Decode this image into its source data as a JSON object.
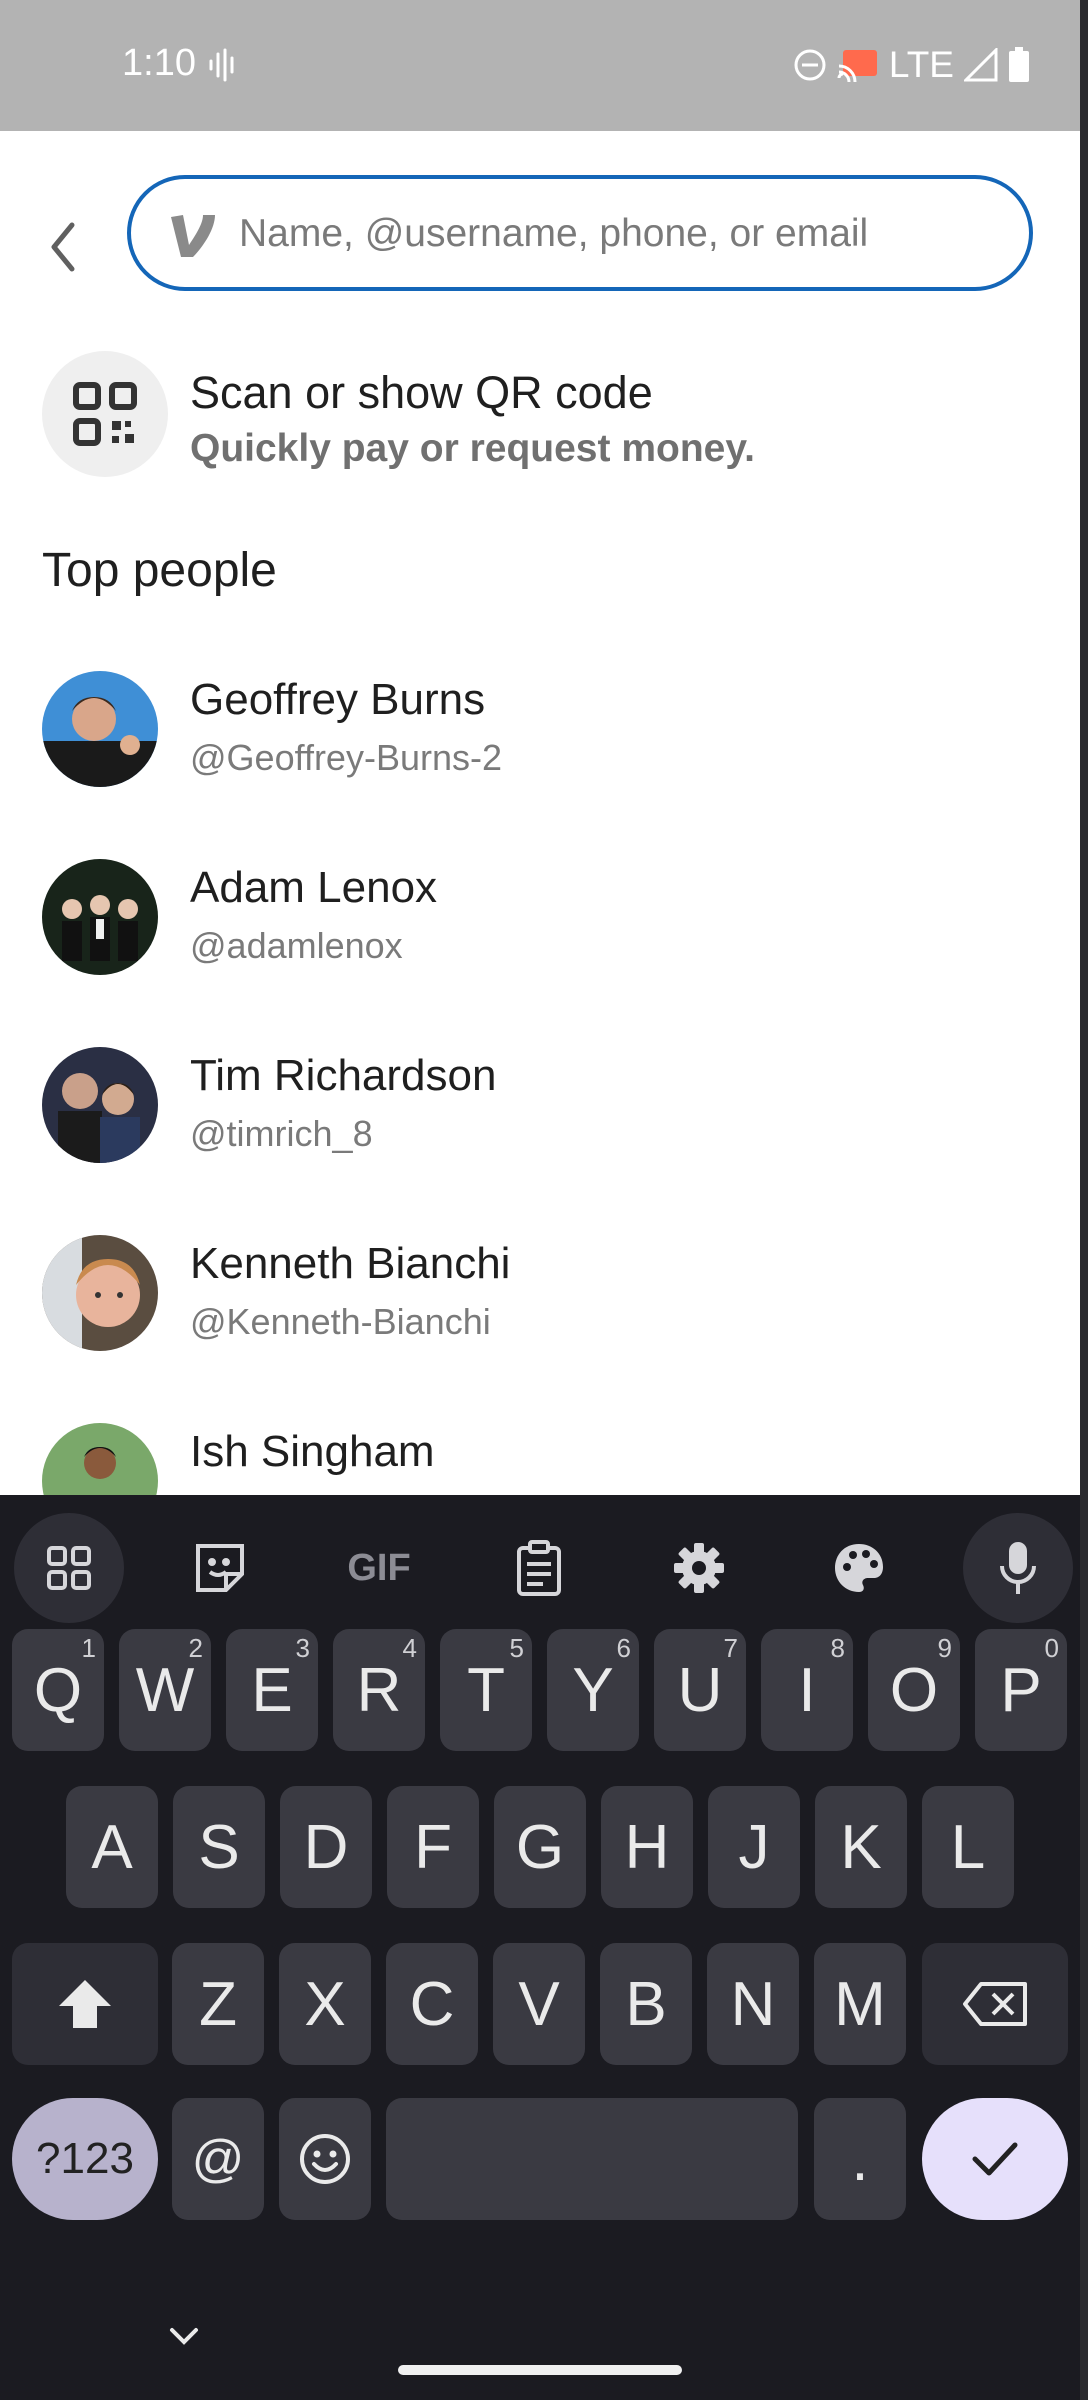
{
  "status": {
    "time": "1:10",
    "network": "LTE"
  },
  "search": {
    "placeholder": "Name, @username, phone, or email",
    "value": ""
  },
  "qr": {
    "title": "Scan or show QR code",
    "subtitle": "Quickly pay or request money."
  },
  "top_people": {
    "title": "Top people",
    "people": [
      {
        "name": "Geoffrey Burns",
        "username": "@Geoffrey-Burns-2"
      },
      {
        "name": "Adam Lenox",
        "username": "@adamlenox"
      },
      {
        "name": "Tim Richardson",
        "username": "@timrich_8"
      },
      {
        "name": "Kenneth Bianchi",
        "username": "@Kenneth-Bianchi"
      },
      {
        "name": "Ish Singham",
        "username": ""
      }
    ]
  },
  "keyboard": {
    "toolbar": [
      "apps-grid-icon",
      "sticker-icon",
      "GIF",
      "clipboard-icon",
      "gear-icon",
      "palette-icon",
      "mic-icon"
    ],
    "gif_label": "GIF",
    "row1": [
      {
        "k": "Q",
        "n": "1"
      },
      {
        "k": "W",
        "n": "2"
      },
      {
        "k": "E",
        "n": "3"
      },
      {
        "k": "R",
        "n": "4"
      },
      {
        "k": "T",
        "n": "5"
      },
      {
        "k": "Y",
        "n": "6"
      },
      {
        "k": "U",
        "n": "7"
      },
      {
        "k": "I",
        "n": "8"
      },
      {
        "k": "O",
        "n": "9"
      },
      {
        "k": "P",
        "n": "0"
      }
    ],
    "row2": [
      "A",
      "S",
      "D",
      "F",
      "G",
      "H",
      "J",
      "K",
      "L"
    ],
    "row3": [
      "Z",
      "X",
      "C",
      "V",
      "B",
      "N",
      "M"
    ],
    "sym_label": "?123",
    "at_label": "@",
    "period_label": "."
  },
  "colors": {
    "accent": "#1466b8",
    "statusbar": "#b3b3b3",
    "keyboard_bg": "#1b1b21"
  }
}
